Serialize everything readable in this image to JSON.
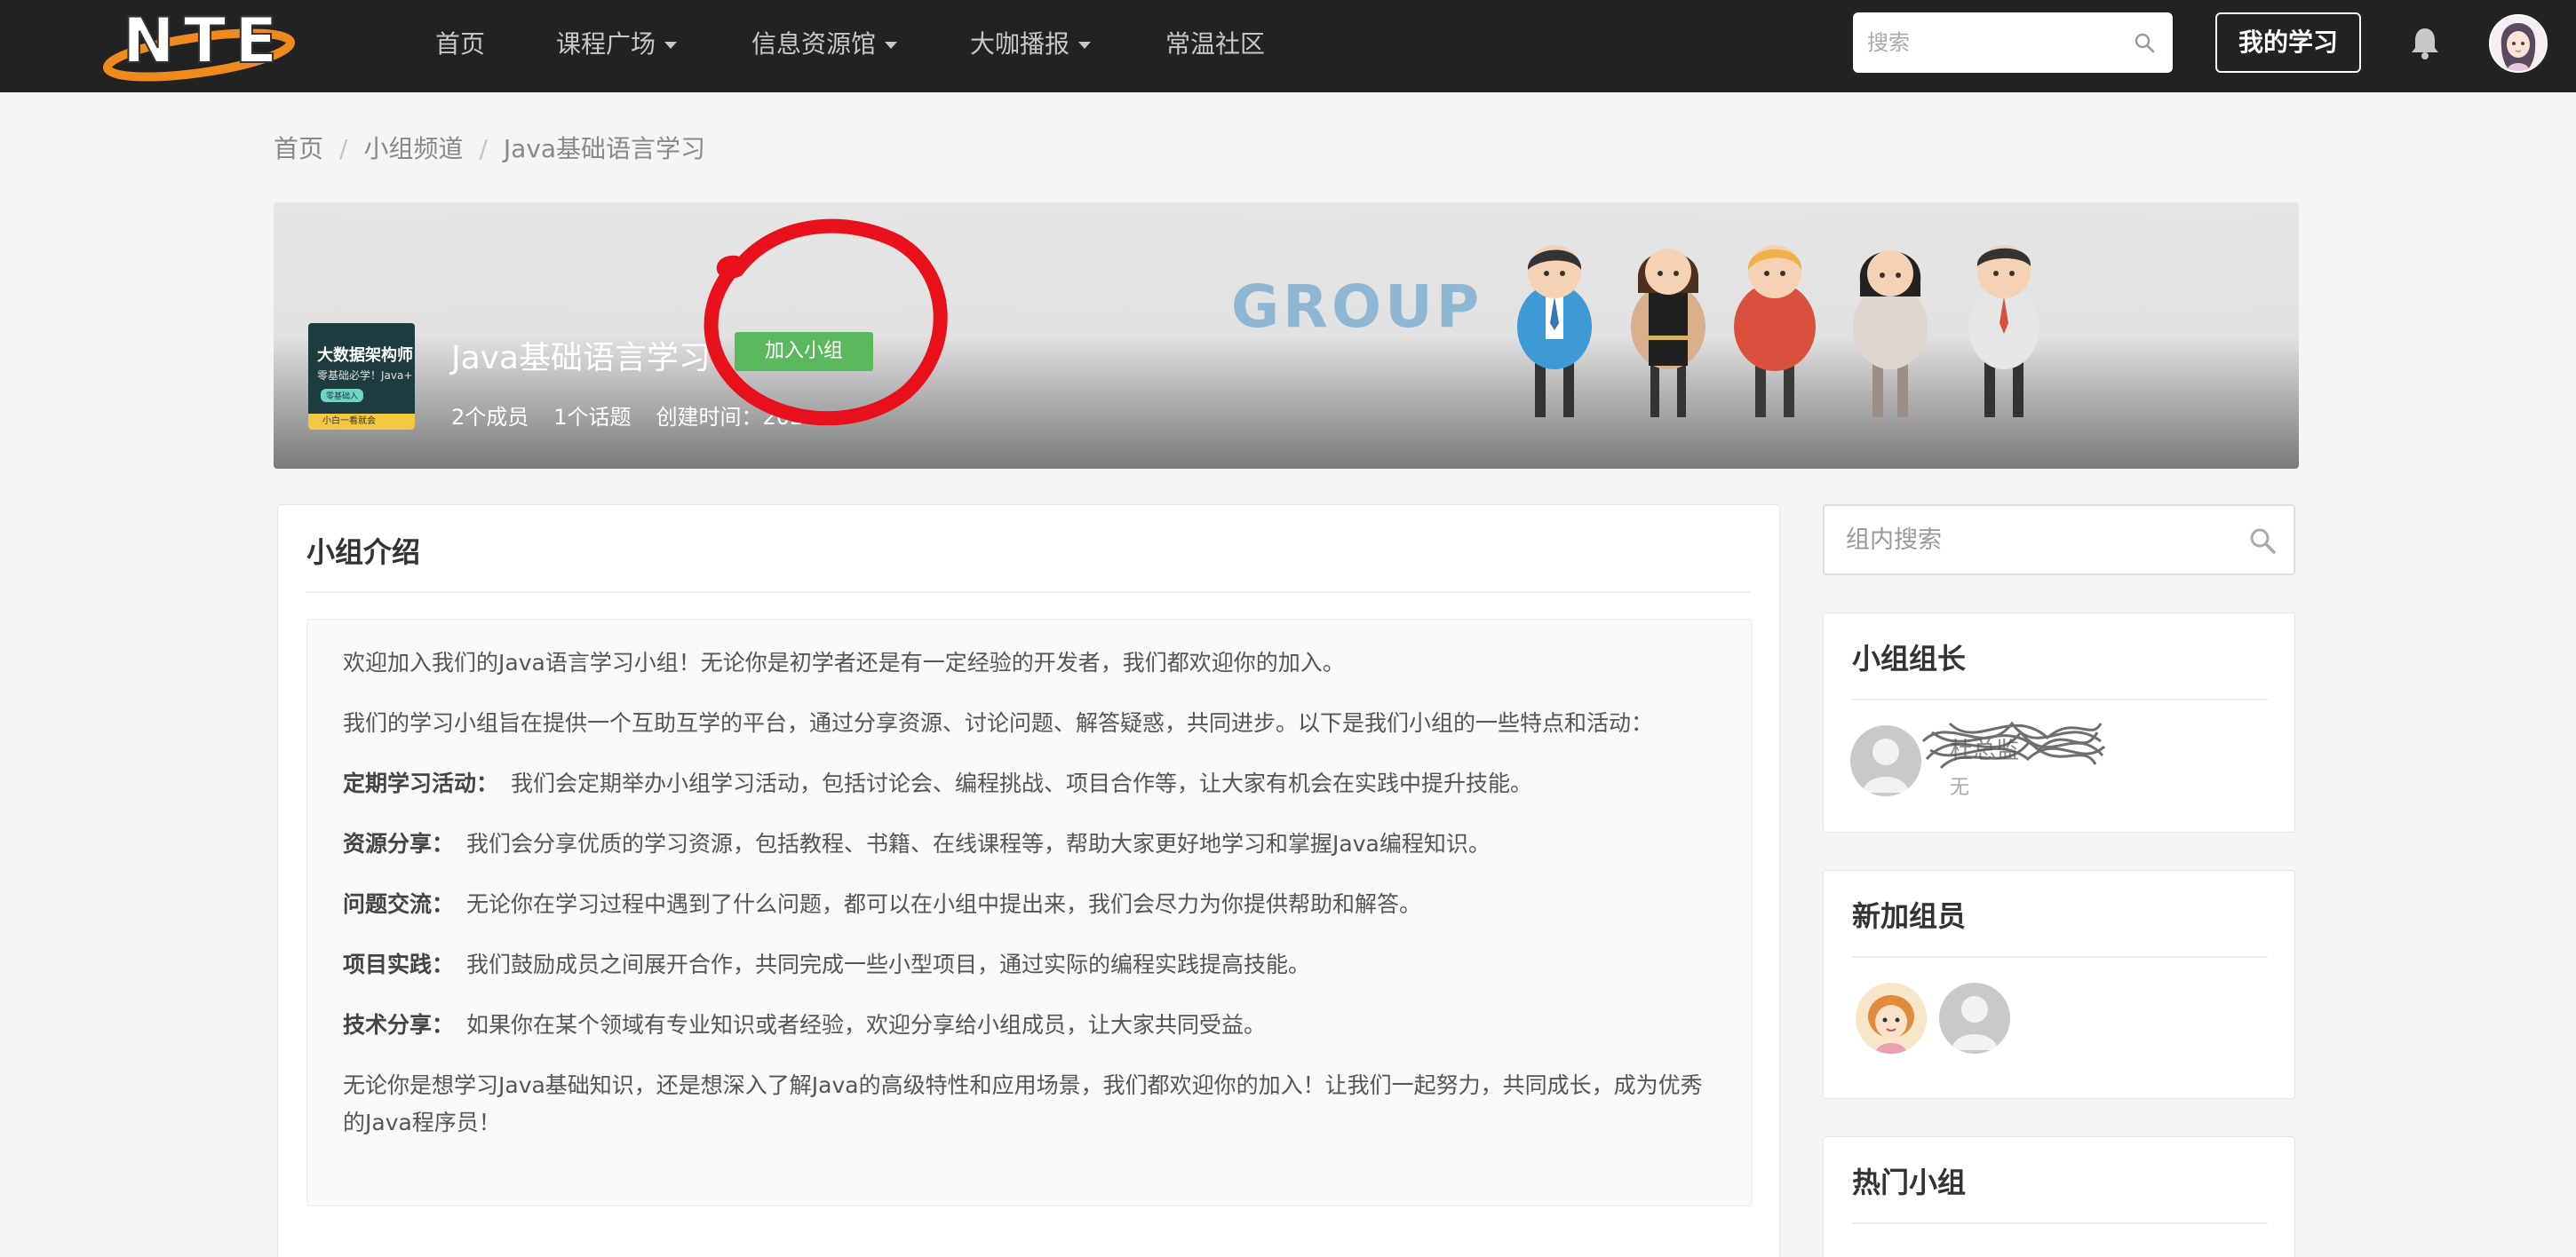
{
  "nav": {
    "logo_text": "NTE",
    "items": [
      {
        "label": "首页",
        "dropdown": false
      },
      {
        "label": "课程广场",
        "dropdown": true
      },
      {
        "label": "信息资源馆",
        "dropdown": true
      },
      {
        "label": "大咖播报",
        "dropdown": true
      },
      {
        "label": "常温社区",
        "dropdown": false
      }
    ],
    "search_placeholder": "搜索",
    "my_study_label": "我的学习",
    "icons": [
      "search-icon",
      "bell-icon",
      "user-avatar"
    ]
  },
  "breadcrumb": [
    "首页",
    "小组频道",
    "Java基础语言学习"
  ],
  "banner": {
    "group_name": "Java基础语言学习",
    "join_label": "加入小组",
    "members": "2个成员",
    "topics": "1个话题",
    "created": "创建时间：202",
    "art_text": "GROUP",
    "cover": {
      "line1": "大数据架构师",
      "line2": "零基础必学！Java+",
      "tag": "零基础入",
      "footer": "小白一看就会"
    },
    "annotation_color": "#e8101b"
  },
  "intro": {
    "title": "小组介绍",
    "paragraphs": [
      {
        "lead": "",
        "text": "欢迎加入我们的Java语言学习小组！无论你是初学者还是有一定经验的开发者，我们都欢迎你的加入。"
      },
      {
        "lead": "",
        "text": "我们的学习小组旨在提供一个互助互学的平台，通过分享资源、讨论问题、解答疑惑，共同进步。以下是我们小组的一些特点和活动："
      },
      {
        "lead": "定期学习活动：",
        "text": "我们会定期举办小组学习活动，包括讨论会、编程挑战、项目合作等，让大家有机会在实践中提升技能。"
      },
      {
        "lead": "资源分享：",
        "text": "我们会分享优质的学习资源，包括教程、书籍、在线课程等，帮助大家更好地学习和掌握Java编程知识。"
      },
      {
        "lead": "问题交流：",
        "text": "无论你在学习过程中遇到了什么问题，都可以在小组中提出来，我们会尽力为你提供帮助和解答。"
      },
      {
        "lead": "项目实践：",
        "text": "我们鼓励成员之间展开合作，共同完成一些小型项目，通过实际的编程实践提高技能。"
      },
      {
        "lead": "技术分享：",
        "text": "如果你在某个领域有专业知识或者经验，欢迎分享给小组成员，让大家共同受益。"
      },
      {
        "lead": "",
        "text": "无论你是想学习Java基础知识，还是想深入了解Java的高级特性和应用场景，我们都欢迎你的加入！让我们一起努力，共同成长，成为优秀的Java程序员！"
      }
    ]
  },
  "sidebar": {
    "search_placeholder": "组内搜索",
    "leader": {
      "title": "小组组长",
      "name": "杜总监",
      "sub": "无"
    },
    "new_members": {
      "title": "新加组员"
    },
    "hot_groups": {
      "title": "热门小组"
    }
  },
  "colors": {
    "nav_bg": "#222222",
    "join_green": "#5cb85c",
    "page_bg": "#f5f5f5"
  }
}
